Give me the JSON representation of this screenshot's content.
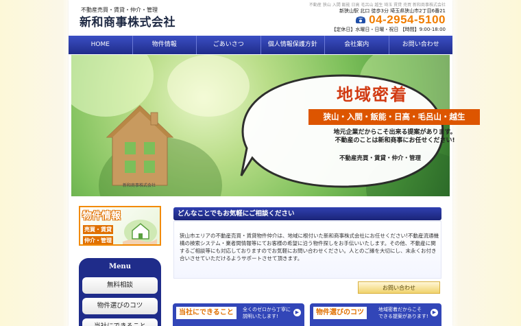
{
  "header": {
    "tagline": "不動産売買・賃貸・仲介・管理",
    "company": "新和商事株式会社",
    "keywords": "不動産 狭山 入間 飯能 日高 毛呂山 越生 埼玉 賃貸 売買 新和商事株式会社",
    "address": "新狭山駅 北口 徒歩3分 埼玉県狭山市2丁目6番21",
    "phone": "04-2954-5100",
    "hours": "【定休日】水曜日・日曜・祝日 【時間】9:00-18:00"
  },
  "nav": [
    "HOME",
    "物件情報",
    "ごあいさつ",
    "個人情報保護方針",
    "会社案内",
    "お問い合わせ"
  ],
  "hero": {
    "title": "地域密着",
    "areas": "狭山・入間・飯能・日高・毛呂山・越生",
    "line1": "地元企業だからこそ出来る提案があります。",
    "line2": "不動産のことは新和商事にお任せください!",
    "services": "不動産売買・賃貸・仲介・管理",
    "house_label": "新和商事株式会社"
  },
  "side": {
    "banner_title": "物件情報",
    "banner_line1": "売買・賃貸",
    "banner_line2": "仲介・管理",
    "menu_title": "Menu",
    "menu_items": [
      "無料相談",
      "物件選びのコツ",
      "当社にできること"
    ]
  },
  "main": {
    "heading": "どんなことでもお気軽にご相談ください",
    "body": "狭山市エリアの不動産売買・賃貸物件仲介は、地域に根付いた新和商事株式会社にお任せください!不動産流通機構の検索システム・業者間情報等にてお客様の希望に沿う物件探しをお手伝いいたします。その他、不動産に関するご相談等にも対応しておりますのでお気軽にお問い合わせください。人とのご縁を大切にし、末永くお付き合いさせていただけるようサポートさせて頂きます。",
    "contact_button": "お問い合わせ",
    "card1_tag": "当社にできること",
    "card1_text1": "全くのゼロから丁寧に",
    "card1_text2": "説明いたします!",
    "card2_tag": "物件選びのコツ",
    "card2_text1": "地域密着だからこそ",
    "card2_text2": "できる提案があります!"
  },
  "colors": {
    "nav": "#1f2c8a",
    "accent": "#f07d00",
    "hero_red": "#d13a12"
  },
  "icons": [
    "phone-icon",
    "arrow-icon"
  ]
}
